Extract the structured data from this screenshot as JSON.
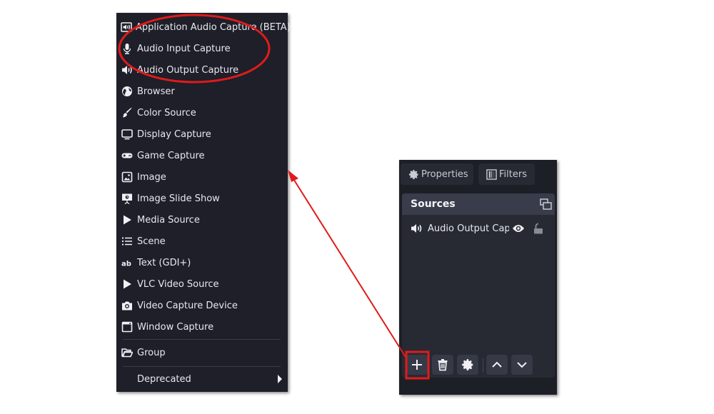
{
  "context_menu": {
    "items": [
      {
        "label": "Application Audio Capture (BETA)",
        "icon": "app-audio-icon"
      },
      {
        "label": "Audio Input Capture",
        "icon": "microphone-icon"
      },
      {
        "label": "Audio Output Capture",
        "icon": "speaker-icon"
      },
      {
        "label": "Browser",
        "icon": "globe-icon"
      },
      {
        "label": "Color Source",
        "icon": "paintbrush-icon"
      },
      {
        "label": "Display Capture",
        "icon": "monitor-icon"
      },
      {
        "label": "Game Capture",
        "icon": "gamepad-icon"
      },
      {
        "label": "Image",
        "icon": "image-icon"
      },
      {
        "label": "Image Slide Show",
        "icon": "slideshow-icon"
      },
      {
        "label": "Media Source",
        "icon": "play-icon"
      },
      {
        "label": "Scene",
        "icon": "list-icon"
      },
      {
        "label": "Text (GDI+)",
        "icon": "text-icon"
      },
      {
        "label": "VLC Video Source",
        "icon": "play-icon"
      },
      {
        "label": "Video Capture Device",
        "icon": "camera-icon"
      },
      {
        "label": "Window Capture",
        "icon": "window-icon"
      }
    ],
    "group": {
      "label": "Group",
      "icon": "folder-open-icon"
    },
    "deprecated": {
      "label": "Deprecated",
      "icon": "chevron-right-icon"
    }
  },
  "dock": {
    "tabs": [
      {
        "label": "Properties",
        "icon": "gear-icon"
      },
      {
        "label": "Filters",
        "icon": "filter-icon"
      }
    ],
    "sources": {
      "title": "Sources",
      "items": [
        {
          "label": "Audio Output Capt",
          "icon": "speaker-icon",
          "visible": true,
          "locked": false
        }
      ],
      "toolbar": [
        "add",
        "remove",
        "properties",
        "move-up",
        "move-down"
      ]
    }
  },
  "annotations": {
    "color": "#e01b1b",
    "highlight_ellipse_target": "Audio Input Capture / Audio Output Capture",
    "highlight_box_target": "add-source-button"
  }
}
